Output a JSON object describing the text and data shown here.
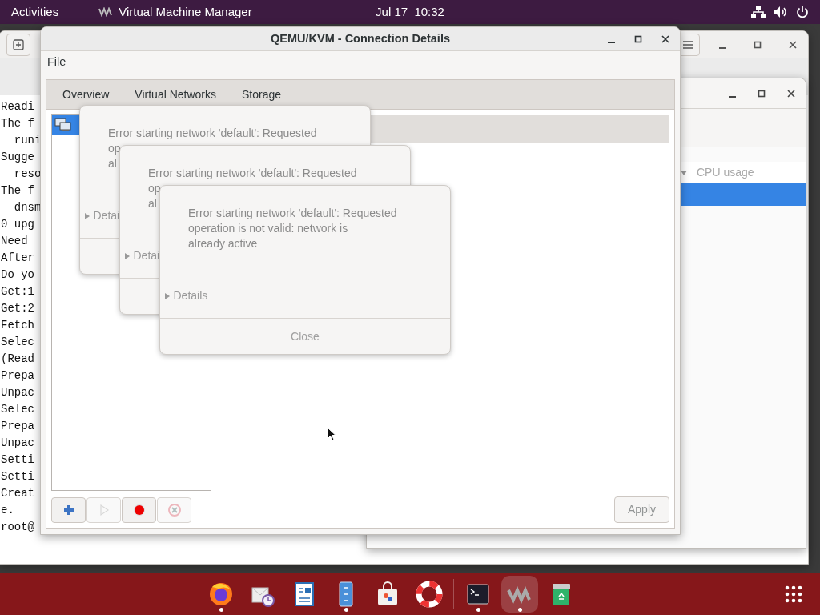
{
  "top_bar": {
    "activities": "Activities",
    "app_name": "Virtual Machine Manager",
    "clock": "Jul 17  10:32"
  },
  "terminal": {
    "lines": [
      "Readi",
      "The f",
      "  runi",
      "Sugge",
      "  reso",
      "The f",
      "  dnsm",
      "0 upg",
      "Need ",
      "After",
      "Do yo",
      "Get:1",
      "Get:2",
      "Fetch",
      "Selec",
      "(Read",
      "Prepa",
      "Unpac",
      "Selec",
      "Prepa",
      "Unpac",
      "Setti",
      "Setti",
      "Creat",
      "e.",
      "root@"
    ]
  },
  "manager": {
    "columns": [
      "CPU usage"
    ],
    "rows": [
      {
        "selected": true
      }
    ]
  },
  "details": {
    "title": "QEMU/KVM - Connection Details",
    "menu": [
      "File"
    ],
    "tabs": [
      "Overview",
      "Virtual Networks",
      "Storage"
    ],
    "networks": [
      {
        "selected": true
      }
    ],
    "toolbar": [
      {
        "kind": "add",
        "disabled": false
      },
      {
        "kind": "start",
        "disabled": true
      },
      {
        "kind": "stop",
        "disabled": false
      },
      {
        "kind": "delete",
        "disabled": true
      }
    ],
    "apply": {
      "label": "Apply",
      "disabled": true
    }
  },
  "dialogs": [
    {
      "message_lines": [
        "Error starting network 'default': Requested",
        "op",
        "al"
      ],
      "details": "Detai"
    },
    {
      "message_lines": [
        "Error starting network 'default': Requested",
        "op",
        "al"
      ],
      "details": "Detai"
    },
    {
      "message_lines": [
        "Error starting network 'default': Requested",
        "operation is not valid: network is",
        "already active"
      ],
      "details": "Details",
      "button": "Close"
    }
  ],
  "dock": {
    "pinned": [
      {
        "kind": "browser",
        "running": true,
        "selected": false
      },
      {
        "kind": "mail",
        "running": false,
        "selected": false
      },
      {
        "kind": "document",
        "running": false,
        "selected": false
      },
      {
        "kind": "files",
        "running": true,
        "selected": false
      },
      {
        "kind": "store",
        "running": false,
        "selected": false
      },
      {
        "kind": "help",
        "running": false,
        "selected": false
      }
    ],
    "other": [
      {
        "kind": "terminal",
        "running": true,
        "selected": false
      },
      {
        "kind": "vm",
        "running": true,
        "selected": true
      },
      {
        "kind": "recycle",
        "running": false,
        "selected": false
      }
    ]
  }
}
